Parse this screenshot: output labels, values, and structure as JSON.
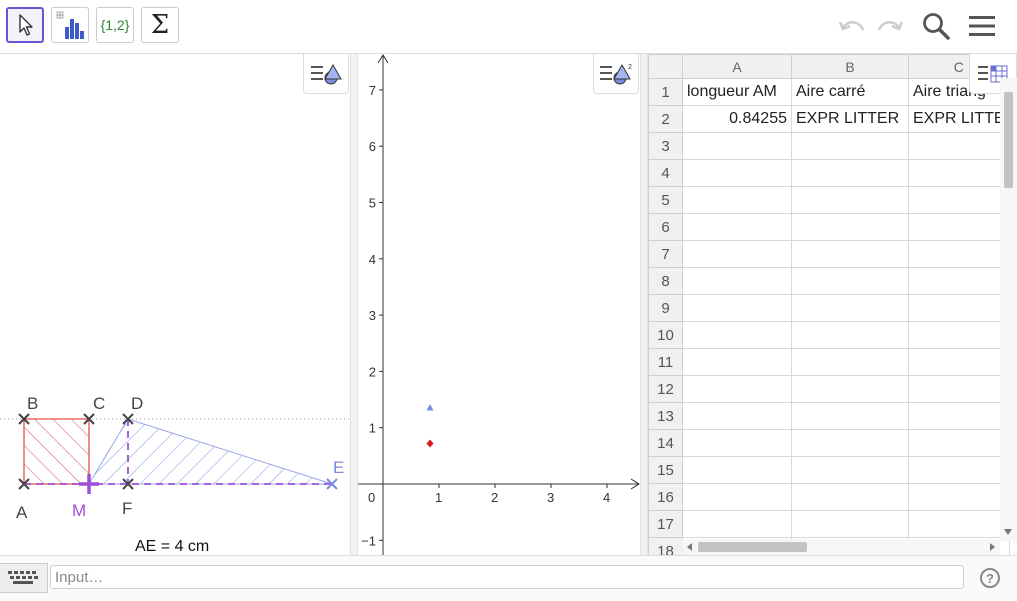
{
  "toolbar": {
    "tools": [
      {
        "name": "move-tool",
        "icon": "arrow-pointer-icon",
        "active": true
      },
      {
        "name": "one-variable-analysis-tool",
        "icon": "bar-chart-icon"
      },
      {
        "name": "create-list-tool",
        "icon": "list-braces-icon",
        "label": "{1,2}"
      },
      {
        "name": "sum-tool",
        "icon": "sigma-icon",
        "label": "Σ"
      }
    ],
    "right": [
      "undo-icon",
      "redo-icon",
      "search-icon",
      "menu-icon"
    ]
  },
  "geometry": {
    "points": {
      "A": "A",
      "B": "B",
      "C": "C",
      "D": "D",
      "E": "E",
      "F": "F",
      "M": "M"
    },
    "caption": "AE = 4 cm",
    "colors": {
      "square": "#e05050",
      "triangle": "#7a8ce0",
      "dashed": "#9b4fd9",
      "point": "#444444",
      "m_point": "#9b4fd9"
    }
  },
  "graphics2": {
    "x_ticks": [
      "0",
      "1",
      "2",
      "3",
      "4"
    ],
    "y_ticks": [
      "7",
      "6",
      "5",
      "4",
      "3",
      "2",
      "1",
      "−1"
    ],
    "points": [
      {
        "name": "triangle-point",
        "x": 0.84,
        "y": 1.35,
        "color": "#7a8ce0"
      },
      {
        "name": "diamond-point",
        "x": 0.84,
        "y": 0.72,
        "color": "#d81b1b"
      }
    ]
  },
  "spreadsheet": {
    "columns": [
      "A",
      "B",
      "C"
    ],
    "rows": [
      {
        "n": "1",
        "cells": [
          "longueur AM",
          "Aire carré",
          "Aire triang"
        ]
      },
      {
        "n": "2",
        "cells": [
          "0.84255",
          "EXPR LITTER",
          "EXPR LITTE"
        ]
      },
      {
        "n": "3",
        "cells": [
          "",
          "",
          ""
        ]
      },
      {
        "n": "4",
        "cells": [
          "",
          "",
          ""
        ]
      },
      {
        "n": "5",
        "cells": [
          "",
          "",
          ""
        ]
      },
      {
        "n": "6",
        "cells": [
          "",
          "",
          ""
        ]
      },
      {
        "n": "7",
        "cells": [
          "",
          "",
          ""
        ]
      },
      {
        "n": "8",
        "cells": [
          "",
          "",
          ""
        ]
      },
      {
        "n": "9",
        "cells": [
          "",
          "",
          ""
        ]
      },
      {
        "n": "10",
        "cells": [
          "",
          "",
          ""
        ]
      },
      {
        "n": "11",
        "cells": [
          "",
          "",
          ""
        ]
      },
      {
        "n": "12",
        "cells": [
          "",
          "",
          ""
        ]
      },
      {
        "n": "13",
        "cells": [
          "",
          "",
          ""
        ]
      },
      {
        "n": "14",
        "cells": [
          "",
          "",
          ""
        ]
      },
      {
        "n": "15",
        "cells": [
          "",
          "",
          ""
        ]
      },
      {
        "n": "16",
        "cells": [
          "",
          "",
          ""
        ]
      },
      {
        "n": "17",
        "cells": [
          "",
          "",
          ""
        ]
      },
      {
        "n": "18",
        "cells": [
          "",
          "",
          ""
        ]
      }
    ]
  },
  "input_bar": {
    "placeholder": "Input…",
    "help": "?"
  }
}
